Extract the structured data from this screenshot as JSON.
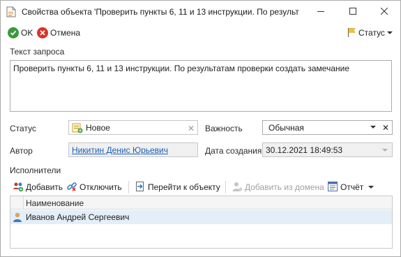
{
  "window": {
    "title": "Свойства объекта 'Проверить пункты 6, 11 и 13 инструкции. По результ"
  },
  "toolbar": {
    "ok_label": "OK",
    "cancel_label": "Отмена",
    "status_label": "Статус"
  },
  "request": {
    "label": "Текст запроса",
    "text": "Проверить пункты 6, 11 и 13 инструкции. По результатам проверки создать замечание"
  },
  "fields": {
    "status_label": "Статус",
    "status_value": "Новое",
    "importance_label": "Важность",
    "importance_value": "Обычная",
    "author_label": "Автор",
    "author_value": "Никитин Денис Юрьевич",
    "created_label": "Дата создания",
    "created_value": "30.12.2021 18:49:53"
  },
  "executors": {
    "label": "Исполнители",
    "toolbar": {
      "add": "Добавить",
      "detach": "Отключить",
      "goto": "Перейти к объекту",
      "add_domain": "Добавить из домена",
      "report": "Отчёт"
    },
    "columns": [
      "Наименование"
    ],
    "rows": [
      {
        "name": "Иванов Андрей Сергеевич"
      }
    ]
  },
  "colors": {
    "accent": "#1c5fb8",
    "ok_green": "#3a9a3a",
    "cancel_red": "#d9342b",
    "selected_row": "#e4eef8"
  }
}
